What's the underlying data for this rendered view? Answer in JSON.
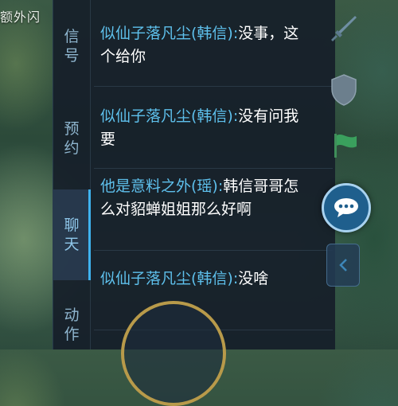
{
  "corner_text": "额外闪",
  "tabs": [
    {
      "label": "信号",
      "chars": [
        "信",
        "号"
      ],
      "active": false
    },
    {
      "label": "预约",
      "chars": [
        "预",
        "约"
      ],
      "active": false
    },
    {
      "label": "聊天",
      "chars": [
        "聊",
        "天"
      ],
      "active": true
    },
    {
      "label": "动作",
      "chars": [
        "动",
        "作"
      ],
      "active": false
    }
  ],
  "messages": [
    {
      "sender": "似仙子落凡尘(韩信):",
      "text": "没事，这个给你"
    },
    {
      "sender": "似仙子落凡尘(韩信):",
      "text": "没有问我要"
    },
    {
      "sender": "他是意料之外(瑶):",
      "text": "韩信哥哥怎么对貂蝉姐姐那么好啊"
    },
    {
      "sender": "似仙子落凡尘(韩信):",
      "text": "没啥"
    }
  ],
  "icons": {
    "sword": "sword-icon",
    "shield": "shield-icon",
    "flag": "flag-icon",
    "chat": "chat-bubble-icon",
    "collapse": "chevron-left-icon"
  },
  "colors": {
    "sender": "#5ec0ec",
    "tab_accent": "#3fb3f0",
    "chat_button": "#1f5f8d"
  }
}
